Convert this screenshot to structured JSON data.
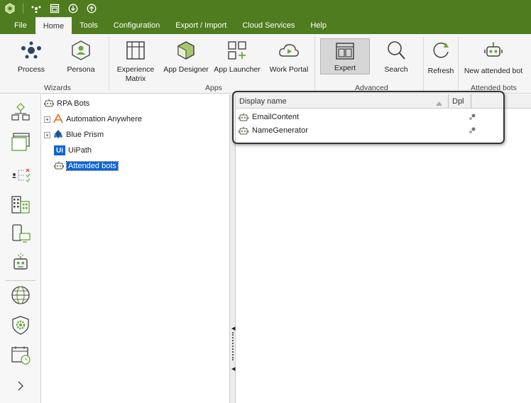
{
  "menu": {
    "tabs": [
      "File",
      "Home",
      "Tools",
      "Configuration",
      "Export / Import",
      "Cloud Services",
      "Help"
    ],
    "active": "Home"
  },
  "ribbon": {
    "buttons": {
      "process": "Process",
      "persona": "Persona",
      "experience_matrix": "Experience Matrix",
      "app_designer": "App Designer",
      "app_launcher": "App Launcher",
      "work_portal": "Work Portal",
      "expert": "Expert",
      "search": "Search",
      "refresh": "Refresh",
      "new_attended_bot": "New attended bot"
    },
    "groups": {
      "wizards": "Wizards",
      "apps": "Apps",
      "advanced": "Advanced",
      "attended_bots": "Attended bots"
    }
  },
  "tree": {
    "root": "RPA Bots",
    "items": [
      "Automation Anywhere",
      "Blue Prism",
      "UiPath",
      "Attended bots"
    ],
    "uipath_badge": "Ui"
  },
  "grid": {
    "columns": [
      "Display name",
      "Dpl"
    ],
    "rows": [
      "EmailContent",
      "NameGenerator"
    ]
  },
  "colors": {
    "brand_green": "#4f7c1e",
    "accent_green": "#8bc34a",
    "selection_blue": "#0a64d8"
  }
}
